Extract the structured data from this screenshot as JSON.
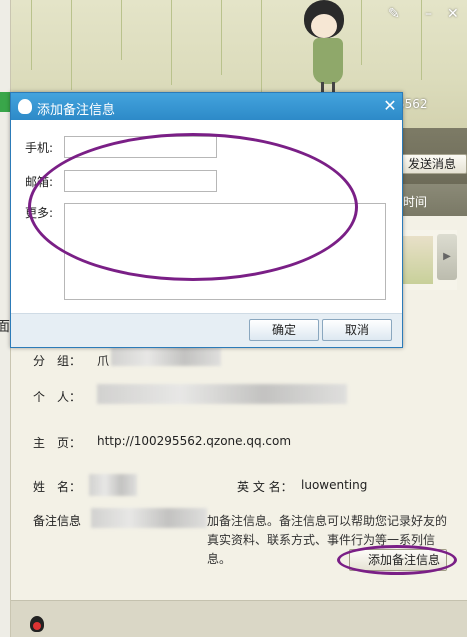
{
  "profile": {
    "id_tail": "5562",
    "send_message_label": "发送消息",
    "tab_time_label": "时间",
    "fields": {
      "group_label": "分　组：",
      "group_value": "爪",
      "personal_label": "个　人：",
      "homepage_label": "主　页：",
      "homepage_value": "http://100295562.qzone.qq.com",
      "surname_label": "姓　名：",
      "english_name_label": "英 文 名：",
      "english_name_value": "luowenting",
      "remark_label": "备注信息",
      "remark_desc": "加备注信息。备注信息可以帮助您记录好友的真实资料、联系方式、事件行为等一系列信息。",
      "add_remark_button": "添加备注信息"
    }
  },
  "left_panel": {
    "partial_glyph": "面"
  },
  "dialog": {
    "title": "添加备注信息",
    "close_glyph": "✕",
    "phone_label": "手机:",
    "phone_value": "",
    "email_label": "邮箱:",
    "email_value": "",
    "more_label": "更多:",
    "more_value": "",
    "ok_label": "确定",
    "cancel_label": "取消"
  },
  "colors": {
    "title_bar": "#2d8ac8",
    "annotation": "#7a1f86",
    "banner": "#dcdcbc"
  },
  "icons": {
    "dialog_icon": "qq-penguin-icon",
    "close": "close-icon",
    "scroll": "chevron-right-icon"
  }
}
